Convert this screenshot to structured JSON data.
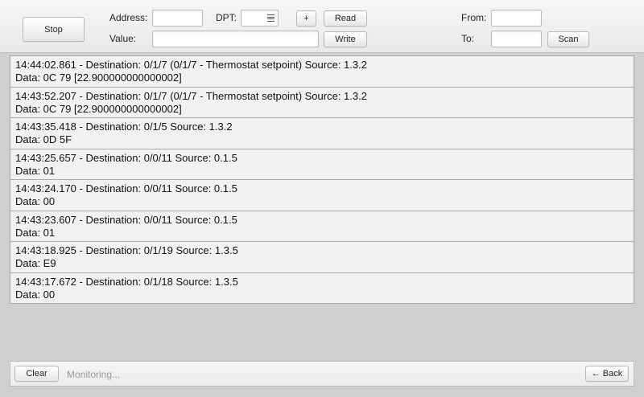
{
  "toolbar": {
    "stop_label": "Stop",
    "address_label": "Address:",
    "address_value": "",
    "dpt_label": "DPT:",
    "dpt_value": "",
    "plus_label": "+",
    "read_label": "Read",
    "value_label": "Value:",
    "value_value": "",
    "write_label": "Write",
    "from_label": "From:",
    "from_value": "",
    "to_label": "To:",
    "to_value": "",
    "scan_label": "Scan"
  },
  "log": {
    "entries": [
      {
        "header": "14:44:02.861 - Destination: 0/1/7 (0/1/7 - Thermostat setpoint) Source: 1.3.2",
        "data": "Data: 0C 79 [22.900000000000002]"
      },
      {
        "header": "14:43:52.207 - Destination: 0/1/7 (0/1/7 - Thermostat setpoint) Source: 1.3.2",
        "data": "Data: 0C 79 [22.900000000000002]"
      },
      {
        "header": "14:43:35.418 - Destination: 0/1/5 Source: 1.3.2",
        "data": "Data: 0D 5F"
      },
      {
        "header": "14:43:25.657 - Destination: 0/0/11 Source: 0.1.5",
        "data": "Data: 01"
      },
      {
        "header": "14:43:24.170 - Destination: 0/0/11 Source: 0.1.5",
        "data": "Data: 00"
      },
      {
        "header": "14:43:23.607 - Destination: 0/0/11 Source: 0.1.5",
        "data": "Data: 01"
      },
      {
        "header": "14:43:18.925 - Destination: 0/1/19 Source: 1.3.5",
        "data": "Data: E9"
      },
      {
        "header": "14:43:17.672 - Destination: 0/1/18 Source: 1.3.5",
        "data": "Data: 00"
      }
    ]
  },
  "footer": {
    "clear_label": "Clear",
    "status_text": "Monitoring...",
    "back_label": "← Back"
  },
  "icons": {
    "dpt_select": "list-icon"
  }
}
